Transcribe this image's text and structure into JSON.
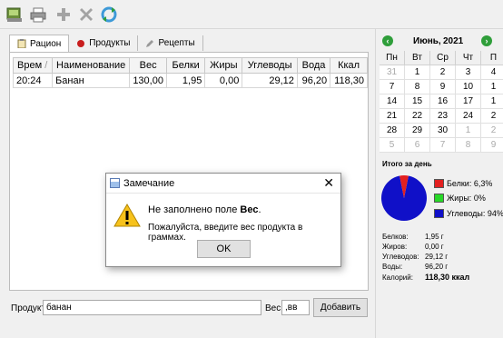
{
  "tabs": [
    {
      "label": "Рацион",
      "icon": "clipboard-icon"
    },
    {
      "label": "Продукты",
      "icon": "red-dot-icon"
    },
    {
      "label": "Рецепты",
      "icon": "pencil-icon"
    }
  ],
  "table": {
    "headers": [
      "Врем",
      "Наименование",
      "Вес",
      "Белки",
      "Жиры",
      "Углеводы",
      "Вода",
      "Ккал"
    ],
    "rows": [
      {
        "time": "20:24",
        "name": "Банан",
        "weight": "130,00",
        "protein": "1,95",
        "fat": "0,00",
        "carbs": "29,12",
        "water": "96,20",
        "kcal": "118,30"
      }
    ]
  },
  "bottom": {
    "product_label": "Продукт",
    "product_value": "банан",
    "weight_label": "Вес",
    "weight_value": ",вв",
    "add_label": "Добавить"
  },
  "dialog": {
    "title": "Замечание",
    "msg1_prefix": "Не заполнено поле ",
    "msg1_field": "Вес",
    "msg1_suffix": ".",
    "msg2": "Пожалуйста, введите вес продукта в граммах.",
    "ok_label": "OK"
  },
  "calendar": {
    "month": "Июнь,",
    "year": "2021",
    "weekdays": [
      "Пн",
      "Вт",
      "Ср",
      "Чт",
      "П"
    ],
    "weeks": [
      [
        "31",
        "1",
        "2",
        "3",
        "4"
      ],
      [
        "7",
        "8",
        "9",
        "10",
        "1"
      ],
      [
        "14",
        "15",
        "16",
        "17",
        "1"
      ],
      [
        "21",
        "22",
        "23",
        "24",
        "2"
      ],
      [
        "28",
        "29",
        "30",
        "1",
        "2"
      ],
      [
        "5",
        "6",
        "7",
        "8",
        "9"
      ]
    ]
  },
  "summary": {
    "title": "Итого за день",
    "legend": [
      {
        "label": "Белки: 6,3%",
        "color": "#e32020"
      },
      {
        "label": "Жиры: 0%",
        "color": "#28d828"
      },
      {
        "label": "Углеводы: 94%",
        "color": "#1010c8"
      }
    ],
    "pie_fractions": {
      "protein": 0.063,
      "fat": 0.0,
      "carbs": 0.937
    },
    "stats": [
      {
        "label": "Белков:",
        "value": "1,95 г"
      },
      {
        "label": "Жиров:",
        "value": "0,00 г"
      },
      {
        "label": "Углеводов:",
        "value": "29,12 г"
      },
      {
        "label": "Воды:",
        "value": "96,20 г"
      },
      {
        "label": "Калорий:",
        "value": "118,30 ккал"
      }
    ]
  }
}
